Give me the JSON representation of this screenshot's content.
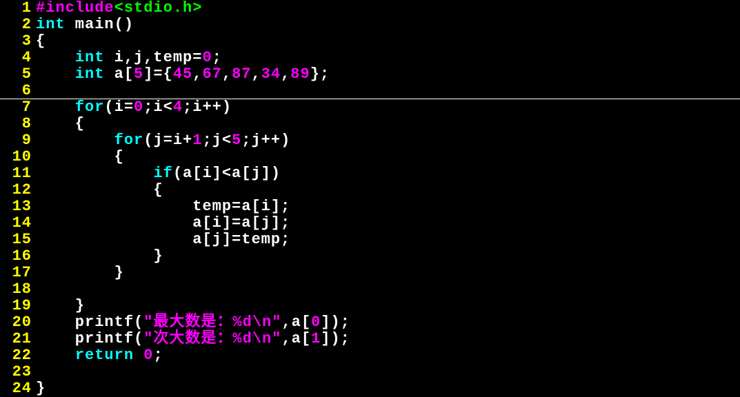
{
  "lines": [
    {
      "n": "1",
      "tokens": [
        {
          "t": "#include",
          "c": "pp"
        },
        {
          "t": "<stdio.h>",
          "c": "hdr"
        }
      ]
    },
    {
      "n": "2",
      "tokens": [
        {
          "t": "int",
          "c": "kw"
        },
        {
          "t": " main()",
          "c": "id"
        }
      ]
    },
    {
      "n": "3",
      "tokens": [
        {
          "t": "{",
          "c": "id"
        }
      ]
    },
    {
      "n": "4",
      "tokens": [
        {
          "t": "    ",
          "c": "id"
        },
        {
          "t": "int",
          "c": "kw"
        },
        {
          "t": " i,j,temp=",
          "c": "id"
        },
        {
          "t": "0",
          "c": "num"
        },
        {
          "t": ";",
          "c": "id"
        }
      ]
    },
    {
      "n": "5",
      "tokens": [
        {
          "t": "    ",
          "c": "id"
        },
        {
          "t": "int",
          "c": "kw"
        },
        {
          "t": " a[",
          "c": "id"
        },
        {
          "t": "5",
          "c": "num"
        },
        {
          "t": "]={",
          "c": "id"
        },
        {
          "t": "45",
          "c": "num"
        },
        {
          "t": ",",
          "c": "id"
        },
        {
          "t": "67",
          "c": "num"
        },
        {
          "t": ",",
          "c": "id"
        },
        {
          "t": "87",
          "c": "num"
        },
        {
          "t": ",",
          "c": "id"
        },
        {
          "t": "34",
          "c": "num"
        },
        {
          "t": ",",
          "c": "id"
        },
        {
          "t": "89",
          "c": "num"
        },
        {
          "t": "};",
          "c": "id"
        }
      ]
    },
    {
      "n": "6",
      "tokens": []
    },
    {
      "n": "7",
      "cursor": true,
      "tokens": [
        {
          "t": "    ",
          "c": "id"
        },
        {
          "t": "for",
          "c": "kw"
        },
        {
          "t": "(i=",
          "c": "id"
        },
        {
          "t": "0",
          "c": "num"
        },
        {
          "t": ";i<",
          "c": "id"
        },
        {
          "t": "4",
          "c": "num"
        },
        {
          "t": ";i++)",
          "c": "id"
        }
      ]
    },
    {
      "n": "8",
      "tokens": [
        {
          "t": "    {",
          "c": "id"
        }
      ]
    },
    {
      "n": "9",
      "tokens": [
        {
          "t": "        ",
          "c": "id"
        },
        {
          "t": "for",
          "c": "kw"
        },
        {
          "t": "(j=i+",
          "c": "id"
        },
        {
          "t": "1",
          "c": "num"
        },
        {
          "t": ";j<",
          "c": "id"
        },
        {
          "t": "5",
          "c": "num"
        },
        {
          "t": ";j++)",
          "c": "id"
        }
      ]
    },
    {
      "n": "10",
      "tokens": [
        {
          "t": "        {",
          "c": "id"
        }
      ]
    },
    {
      "n": "11",
      "tokens": [
        {
          "t": "            ",
          "c": "id"
        },
        {
          "t": "if",
          "c": "kw"
        },
        {
          "t": "(a[i]<a[j])",
          "c": "id"
        }
      ]
    },
    {
      "n": "12",
      "tokens": [
        {
          "t": "            {",
          "c": "id"
        }
      ]
    },
    {
      "n": "13",
      "tokens": [
        {
          "t": "                temp=a[i];",
          "c": "id"
        }
      ]
    },
    {
      "n": "14",
      "tokens": [
        {
          "t": "                a[i]=a[j];",
          "c": "id"
        }
      ]
    },
    {
      "n": "15",
      "tokens": [
        {
          "t": "                a[j]=temp;",
          "c": "id"
        }
      ]
    },
    {
      "n": "16",
      "tokens": [
        {
          "t": "            }",
          "c": "id"
        }
      ]
    },
    {
      "n": "17",
      "tokens": [
        {
          "t": "        }",
          "c": "id"
        }
      ]
    },
    {
      "n": "18",
      "tokens": []
    },
    {
      "n": "19",
      "tokens": [
        {
          "t": "    }",
          "c": "id"
        }
      ]
    },
    {
      "n": "20",
      "tokens": [
        {
          "t": "    printf(",
          "c": "id"
        },
        {
          "t": "\"最大数是：%d\\n\"",
          "c": "str"
        },
        {
          "t": ",a[",
          "c": "id"
        },
        {
          "t": "0",
          "c": "num"
        },
        {
          "t": "]);",
          "c": "id"
        }
      ]
    },
    {
      "n": "21",
      "tokens": [
        {
          "t": "    printf(",
          "c": "id"
        },
        {
          "t": "\"次大数是：%d\\n\"",
          "c": "str"
        },
        {
          "t": ",a[",
          "c": "id"
        },
        {
          "t": "1",
          "c": "num"
        },
        {
          "t": "]);",
          "c": "id"
        }
      ]
    },
    {
      "n": "22",
      "tokens": [
        {
          "t": "    ",
          "c": "id"
        },
        {
          "t": "return",
          "c": "kw"
        },
        {
          "t": " ",
          "c": "id"
        },
        {
          "t": "0",
          "c": "num"
        },
        {
          "t": ";",
          "c": "id"
        }
      ]
    },
    {
      "n": "23",
      "tokens": []
    },
    {
      "n": "24",
      "tokens": [
        {
          "t": "}",
          "c": "id"
        }
      ]
    }
  ]
}
